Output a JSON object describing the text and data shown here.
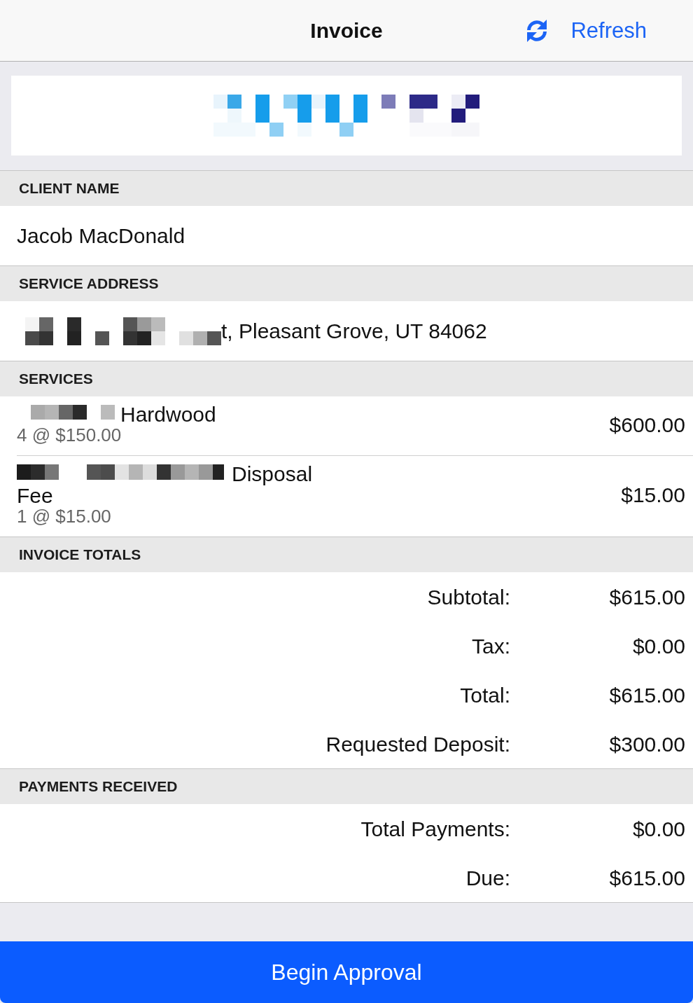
{
  "nav_bar": {
    "title": "Invoice",
    "refresh_button": {
      "label": "Refresh"
    }
  },
  "sections": [
    {
      "kind": "field",
      "header": "CLIENT NAME",
      "value": "Jacob MacDonald",
      "redacted": false
    },
    {
      "kind": "field",
      "header": "SERVICE ADDRESS",
      "value": "t, Pleasant Grove, UT 84062",
      "redacted": true
    },
    {
      "kind": "services",
      "header": "SERVICES",
      "items": [
        {
          "name_lines": [
            "Hardwood"
          ],
          "redacted": true,
          "quantity": "4 @ $150.00",
          "amount": "$600.00"
        },
        {
          "name_lines": [
            "Disposal",
            "Fee"
          ],
          "redacted": true,
          "quantity": "1 @ $15.00",
          "amount": "$15.00"
        }
      ]
    },
    {
      "kind": "totals",
      "header": "INVOICE TOTALS",
      "rows": [
        {
          "label": "Subtotal:",
          "value": "$615.00"
        },
        {
          "label": "Tax:",
          "value": "$0.00"
        },
        {
          "label": "Total:",
          "value": "$615.00"
        },
        {
          "label": "Requested Deposit:",
          "value": "$300.00"
        }
      ]
    },
    {
      "kind": "totals",
      "header": "PAYMENTS RECEIVED",
      "rows": [
        {
          "label": "Total Payments:",
          "value": "$0.00"
        },
        {
          "label": "Due:",
          "value": "$615.00"
        }
      ]
    }
  ],
  "primary_button": {
    "label": "Begin Approval"
  }
}
